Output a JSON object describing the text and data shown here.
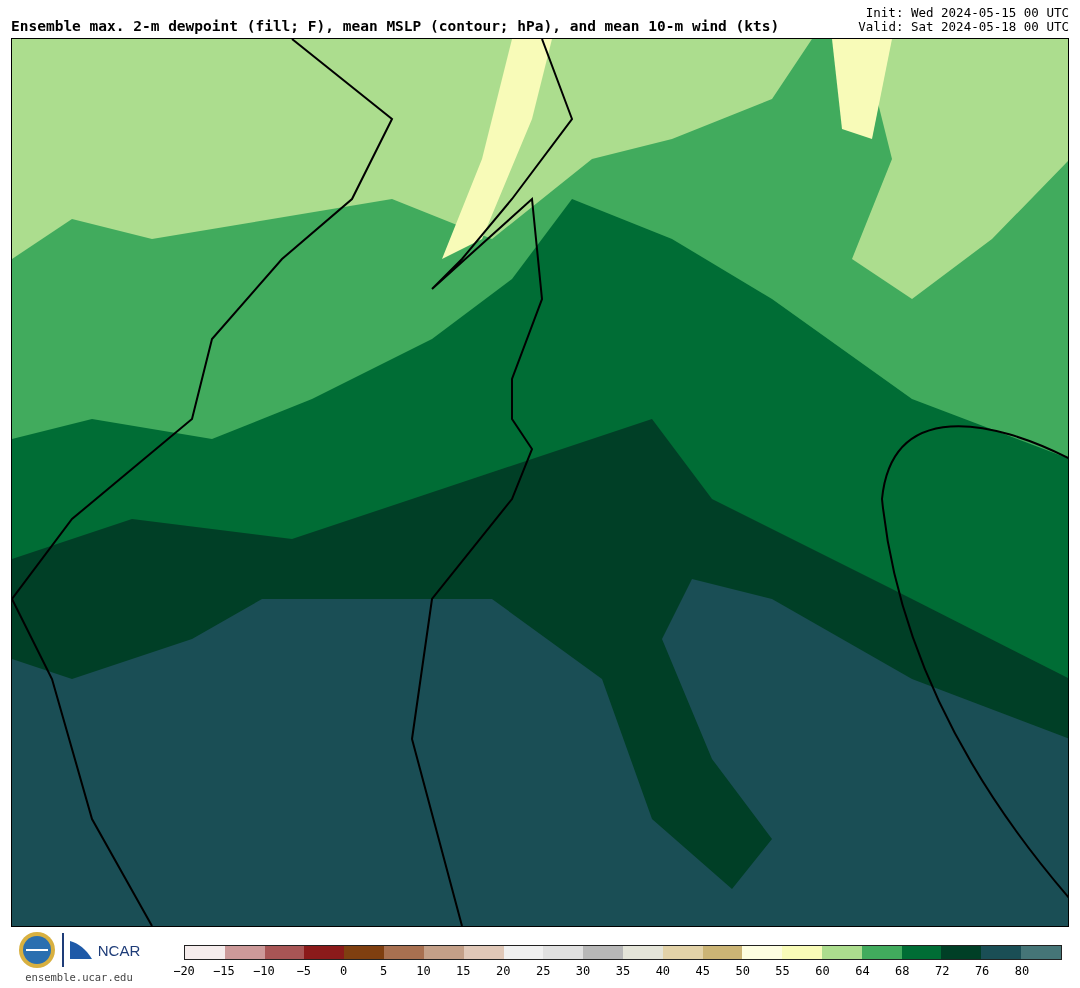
{
  "title": "Ensemble max. 2-m dewpoint (fill; F), mean MSLP (contour; hPa), and mean 10-m wind (kts)",
  "init": "Init: Wed 2024-05-15 00 UTC",
  "valid": "Valid: Sat 2024-05-18 00 UTC",
  "logo": {
    "text": "NCAR"
  },
  "site": "ensemble.ucar.edu",
  "colorbar": {
    "segments": [
      {
        "color": "#f5ecec"
      },
      {
        "color": "#cc9999"
      },
      {
        "color": "#a85555"
      },
      {
        "color": "#8b1a1a"
      },
      {
        "color": "#7f3f10"
      },
      {
        "color": "#a87050"
      },
      {
        "color": "#c4a088"
      },
      {
        "color": "#e0c8b8"
      },
      {
        "color": "#f0f0f0"
      },
      {
        "color": "#e0e0e0"
      },
      {
        "color": "#b8b8b8"
      },
      {
        "color": "#e4e4d8"
      },
      {
        "color": "#e2d2a8"
      },
      {
        "color": "#cbb475"
      },
      {
        "color": "#fdfde0"
      },
      {
        "color": "#f8fbb8"
      },
      {
        "color": "#acdd8e"
      },
      {
        "color": "#41ab5d"
      },
      {
        "color": "#006d35"
      },
      {
        "color": "#003f26"
      },
      {
        "color": "#1a4e55"
      },
      {
        "color": "#457577"
      }
    ],
    "labels": [
      "−20",
      "−15",
      "−10",
      "−5",
      "0",
      "5",
      "10",
      "15",
      "20",
      "25",
      "30",
      "35",
      "40",
      "45",
      "50",
      "55",
      "60",
      "64",
      "68",
      "72",
      "76",
      "80"
    ]
  }
}
